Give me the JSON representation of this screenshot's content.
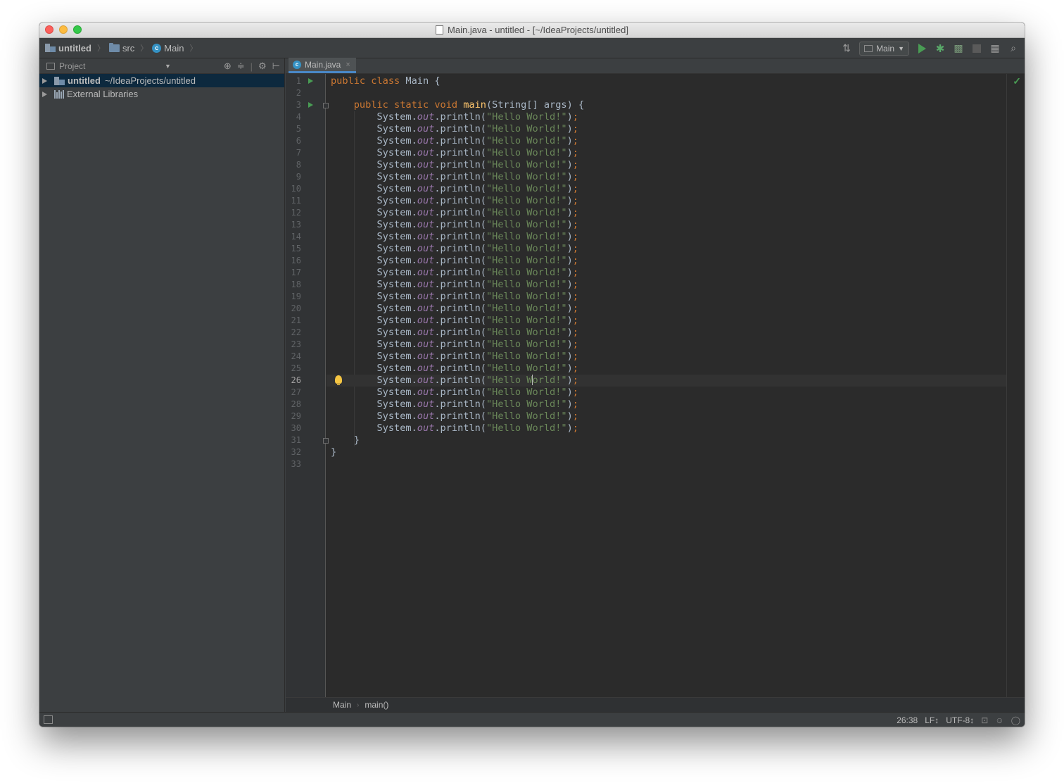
{
  "window": {
    "title": "Main.java - untitled - [~/IdeaProjects/untitled]"
  },
  "navbar": {
    "crumbs": [
      "untitled",
      "src",
      "Main"
    ],
    "run_config": "Main"
  },
  "project_panel": {
    "header": "Project",
    "tree": [
      {
        "name": "untitled",
        "path": "~/IdeaProjects/untitled"
      },
      {
        "name": "External Libraries"
      }
    ]
  },
  "editor": {
    "tab_label": "Main.java",
    "code_lines": {
      "l1_kw": "public class ",
      "l1_rest": "Main {",
      "l3_kw": "public static void ",
      "l3_fn": "main",
      "l3_rest": "(String[] args) {",
      "println_prefix": "System.",
      "println_field": "out",
      "println_method": ".println(",
      "println_string": "\"Hello World!\"",
      "println_close": ")",
      "println_semi": ";",
      "close_method": "}",
      "close_class": "}"
    },
    "println_line_count": 27,
    "caret_line": 26,
    "total_lines": 33,
    "breadcrumb": [
      "Main",
      "main()"
    ]
  },
  "statusbar": {
    "position": "26:38",
    "line_separator": "LF↕",
    "encoding": "UTF-8↕"
  },
  "colors": {
    "keyword": "#cc7832",
    "function": "#ffc66d",
    "string": "#6a8759",
    "field": "#9876aa",
    "text": "#a9b7c6",
    "background": "#2b2b2b",
    "run_green": "#499c54",
    "selection": "#0d293e"
  }
}
